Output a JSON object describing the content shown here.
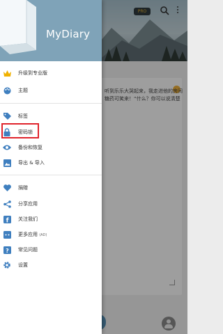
{
  "app": {
    "logo_text": "MyDiary"
  },
  "top_bar": {
    "pro_badge": "PRO"
  },
  "entry": {
    "line1": "听到乐乐大哭起来，我走进他的房间",
    "line2": "糖药可笑来！“什么？你可以说清楚"
  },
  "drawer": {
    "items": [
      {
        "key": "upgrade",
        "label": "升级到专业版",
        "icon": "crown-icon"
      },
      {
        "key": "theme",
        "label": "主题",
        "icon": "palette-icon"
      },
      {
        "key": "tags",
        "label": "标签",
        "icon": "tag-icon"
      },
      {
        "key": "lock",
        "label": "密码锁",
        "icon": "lock-icon"
      },
      {
        "key": "backup",
        "label": "备份和恢复",
        "icon": "eye-icon"
      },
      {
        "key": "export",
        "label": "导出 & 导入",
        "icon": "image-icon"
      },
      {
        "key": "donate",
        "label": "捐赠",
        "icon": "heart-icon"
      },
      {
        "key": "share",
        "label": "分享应用",
        "icon": "share-icon"
      },
      {
        "key": "follow",
        "label": "关注我们",
        "icon": "facebook-icon"
      },
      {
        "key": "more_apps",
        "label": "更多应用",
        "badge": "(AD)",
        "icon": "apps-icon"
      },
      {
        "key": "faq",
        "label": "常见问题",
        "icon": "help-icon"
      },
      {
        "key": "settings",
        "label": "设置",
        "icon": "gear-icon"
      }
    ]
  },
  "colors": {
    "accent": "#3f7fbf",
    "crown": "#f0b100",
    "highlight": "#e0232b"
  }
}
